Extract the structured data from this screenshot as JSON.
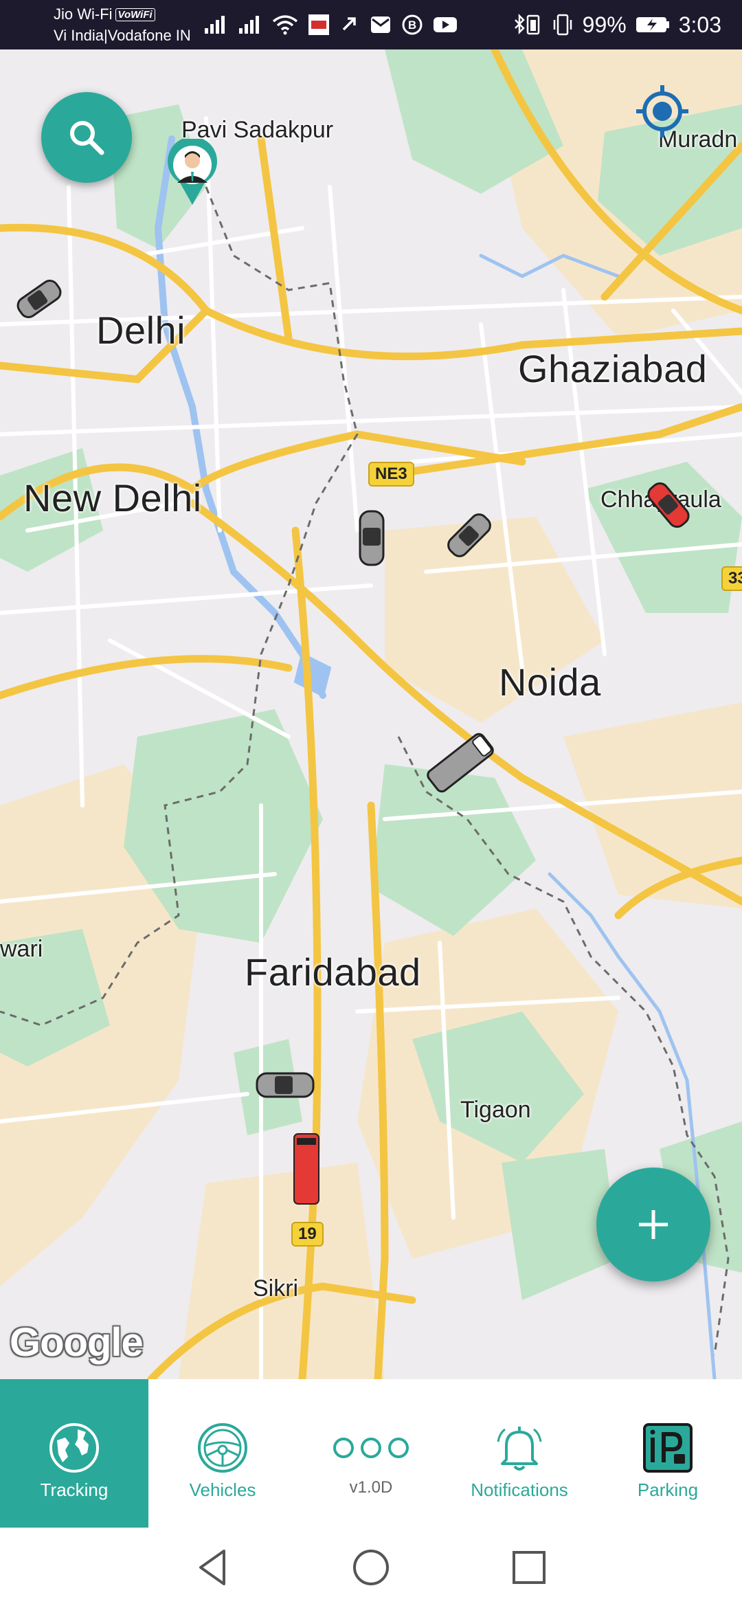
{
  "status_bar": {
    "carrier_1": "Jio Wi-Fi",
    "vowifi_badge": "VoWiFi",
    "carrier_2": "Vi India|Vodafone IN",
    "battery": "99%",
    "time": "3:03"
  },
  "map": {
    "places": {
      "pavi_sadakpur": "Pavi Sadakpur",
      "muradnagar": "Muradn",
      "delhi": "Delhi",
      "ghaziabad": "Ghaziabad",
      "new_delhi": "New Delhi",
      "chhapraula": "Chhaprаula",
      "noida": "Noida",
      "rewari": "wari",
      "faridabad": "Faridabad",
      "tigaon": "Tigaon",
      "sikri": "Sikri"
    },
    "shields": {
      "ne3": "NE3",
      "nh19": "19",
      "nh33": "33"
    },
    "attribution": "Google",
    "vehicles": [
      {
        "type": "car",
        "color": "#9e9e9e"
      },
      {
        "type": "car",
        "color": "#9e9e9e"
      },
      {
        "type": "car",
        "color": "#9e9e9e"
      },
      {
        "type": "car",
        "color": "#e53935"
      },
      {
        "type": "truck",
        "color": "#9e9e9e"
      },
      {
        "type": "car",
        "color": "#9e9e9e"
      },
      {
        "type": "bus",
        "color": "#e53935"
      }
    ],
    "colors": {
      "land": "#eeecef",
      "park": "#bfe3c6",
      "built": "#f6e6c9",
      "highway": "#f4c542",
      "road": "#ffffff",
      "water": "#9ec3f0",
      "accent": "#2aa99a"
    }
  },
  "bottom_nav": {
    "items": [
      {
        "label": "Tracking",
        "icon": "globe-icon",
        "active": true
      },
      {
        "label": "Vehicles",
        "icon": "steering-wheel-icon",
        "active": false
      },
      {
        "label": "v1.0D",
        "icon": "more-dots-icon",
        "active": false
      },
      {
        "label": "Notifications",
        "icon": "bell-icon",
        "active": false
      },
      {
        "label": "Parking",
        "icon": "parking-icon",
        "active": false
      }
    ]
  }
}
